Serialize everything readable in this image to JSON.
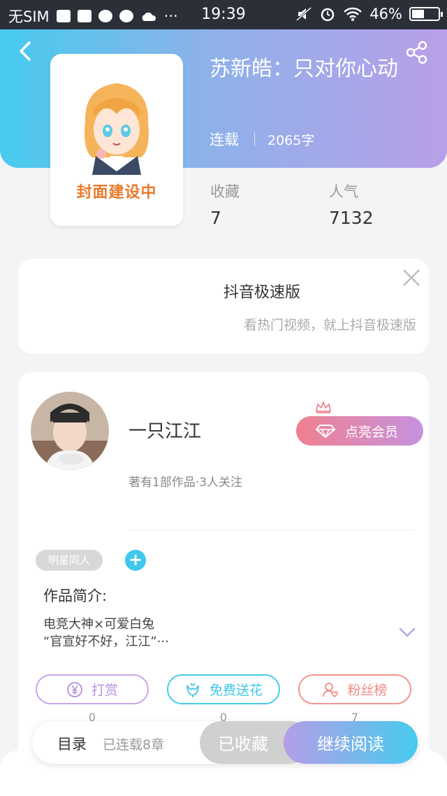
{
  "status_bar": {
    "carrier": "无SIM",
    "time": "19:39",
    "battery": "46%",
    "battery_level": 0.46,
    "dots": "···"
  },
  "book": {
    "title": "苏新皓：只对你心动",
    "status": "连载",
    "word_count": "2065字",
    "cover_text": "封面建设中",
    "collect_label": "收藏",
    "collect_value": "7",
    "popularity_label": "人气",
    "popularity_value": "7132"
  },
  "ad": {
    "title": "抖音极速版",
    "subtitle": "看热门视频，就上抖音极速版"
  },
  "author": {
    "name": "一只江江",
    "info": "著有1部作品·3人关注",
    "vip_button": "点亮会员"
  },
  "tags": [
    "明星同人"
  ],
  "add_tag": "+",
  "intro": {
    "label": "作品简介:",
    "line1": "电竞大神×可爱白兔",
    "line2": "“官宣好不好，江江”···"
  },
  "actions": [
    {
      "label": "打赏",
      "count": "0"
    },
    {
      "label": "免费送花",
      "count": "0"
    },
    {
      "label": "粉丝榜",
      "count": "7"
    }
  ],
  "bottom_bar": {
    "toc": "目录",
    "chapters": "已连载8章",
    "collected": "已收藏",
    "continue": "继续阅读"
  },
  "colors": {
    "header_start": "#46cbee",
    "header_end": "#b99fe8",
    "accent_blue": "#3fc8ee",
    "accent_purple": "#b58ee0",
    "accent_red": "#ef8a83",
    "cover_text": "#e87a2c"
  }
}
